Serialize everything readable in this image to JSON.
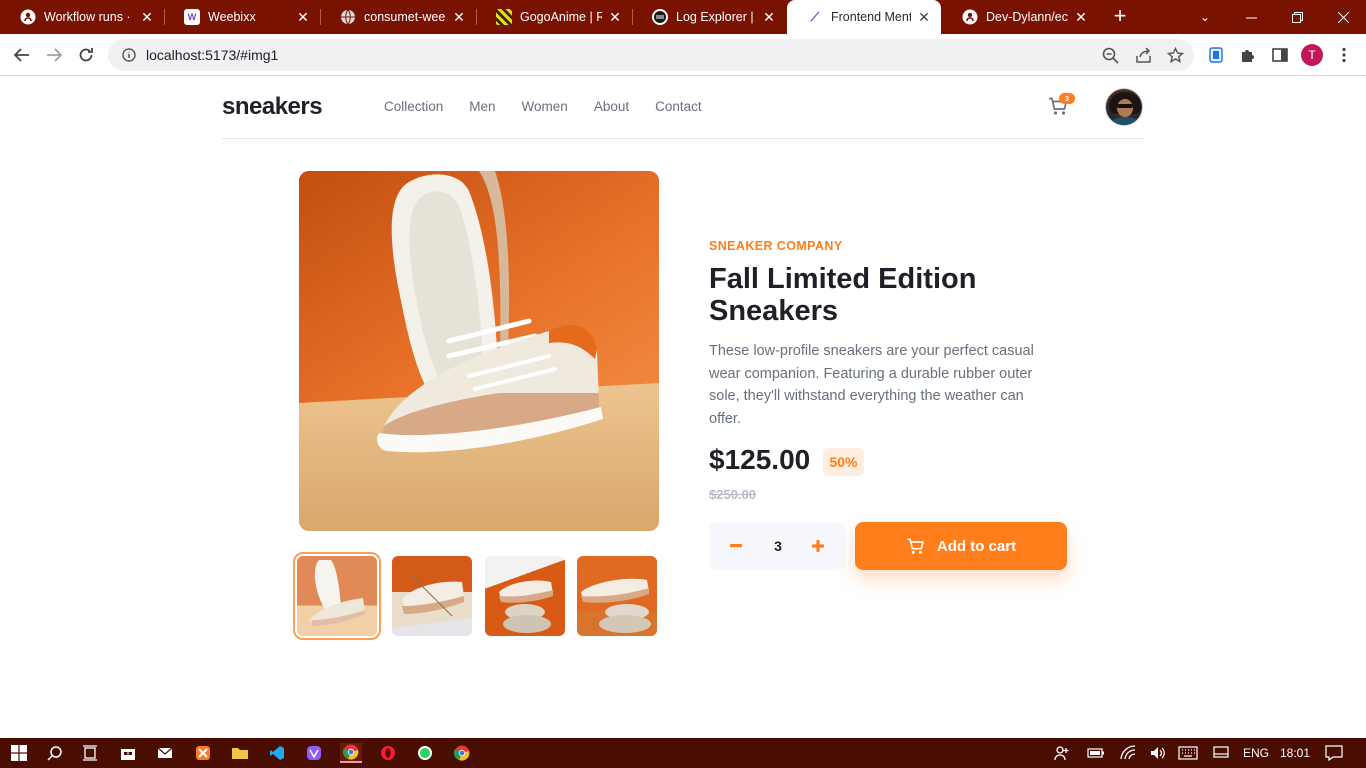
{
  "browser": {
    "tabs": [
      {
        "title": "Workflow runs · ",
        "favicon": "github-icon"
      },
      {
        "title": "Weebixx",
        "favicon": "weebixx-icon"
      },
      {
        "title": "consumet-weebi",
        "favicon": "globe-icon"
      },
      {
        "title": "GogoAnime | Re",
        "favicon": "gogoanime-icon"
      },
      {
        "title": "Log Explorer | Ra",
        "favicon": "railway-icon"
      },
      {
        "title": "Frontend Mento",
        "favicon": "frontend-mentor-icon",
        "active": true
      },
      {
        "title": "Dev-Dylann/eco",
        "favicon": "github-icon"
      }
    ],
    "url": "localhost:5173/#img1",
    "profile_initial": "T"
  },
  "site": {
    "logo": "sneakers",
    "nav": [
      "Collection",
      "Men",
      "Women",
      "About",
      "Contact"
    ],
    "cart_count": "3"
  },
  "product": {
    "company": "SNEAKER COMPANY",
    "title": "Fall Limited Edition Sneakers",
    "description": "These low-profile sneakers are your perfect casual wear companion. Featuring a durable rubber outer sole, they'll withstand everything the weather can offer.",
    "price": "$125.00",
    "discount": "50%",
    "old_price": "$250.00",
    "quantity": "3",
    "add_to_cart": "Add to cart"
  },
  "taskbar": {
    "language": "ENG",
    "time": "18:01"
  },
  "colors": {
    "accent": "#ff7d1a",
    "tab_strip": "#7a1202",
    "taskbar": "#4a0d02"
  }
}
